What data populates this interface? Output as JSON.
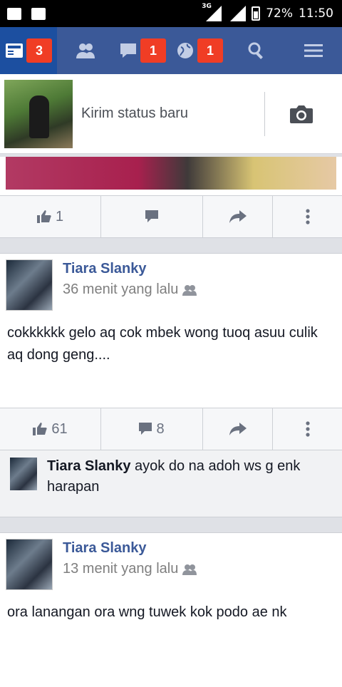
{
  "statusbar": {
    "network": "3G",
    "battery": "72%",
    "time": "11:50"
  },
  "nav": {
    "news_badge": "3",
    "messages_badge": "1",
    "notifications_badge": "1"
  },
  "composer": {
    "placeholder": "Kirim status baru"
  },
  "first_post_actions": {
    "like_count": "1"
  },
  "posts": [
    {
      "author": "Tiara Slanky",
      "time": "36 menit yang lalu",
      "text": "cokkkkkk gelo aq cok mbek wong tuoq asuu culik aq dong geng....",
      "like_count": "61",
      "comment_count": "8",
      "comment": {
        "author": "Tiara Slanky",
        "text": "ayok do na adoh ws g enk harapan"
      }
    },
    {
      "author": "Tiara Slanky",
      "time": "13 menit yang lalu",
      "text": "ora lanangan ora wng tuwek kok podo ae nk"
    }
  ]
}
